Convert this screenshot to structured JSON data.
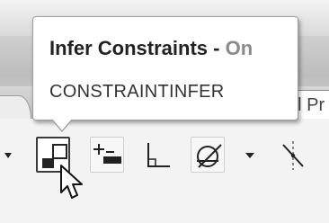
{
  "tooltip": {
    "title": "Infer Constraints - ",
    "status": "On",
    "command": "CONSTRAINTINFER"
  },
  "ribbon": {
    "tab_fragment": "al Pr"
  },
  "toolbar": {
    "buttons": [
      {
        "name": "infer-constraints-button",
        "icon": "infer-constraints-icon",
        "active": true
      },
      {
        "name": "auto-constrain-button",
        "icon": "auto-constrain-icon",
        "active": false
      },
      {
        "name": "perpendicular-button",
        "icon": "perpendicular-icon",
        "active": false
      },
      {
        "name": "tangent-button",
        "icon": "tangent-icon",
        "active": false
      },
      {
        "name": "symmetric-button",
        "icon": "symmetric-icon",
        "active": false
      }
    ]
  },
  "colors": {
    "tooltip_status": "#8a8a8a",
    "tooltip_border": "#9e9e9e",
    "active_button_border": "#3a3a3a"
  }
}
